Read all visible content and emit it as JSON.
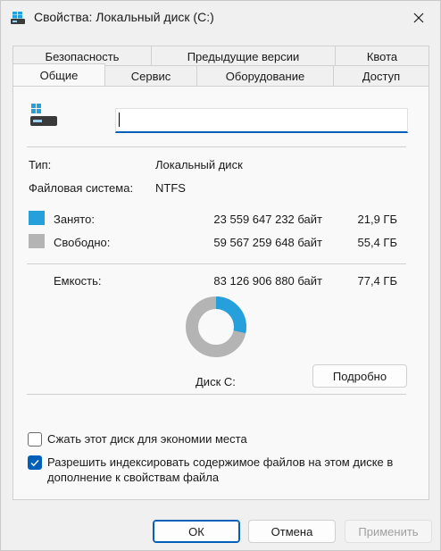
{
  "window": {
    "title": "Свойства: Локальный диск (C:)"
  },
  "tabs_back": [
    "Безопасность",
    "Предыдущие версии",
    "Квота"
  ],
  "tabs_front": [
    "Общие",
    "Сервис",
    "Оборудование",
    "Доступ"
  ],
  "general": {
    "name_value": "",
    "type_label": "Тип:",
    "type_value": "Локальный диск",
    "fs_label": "Файловая система:",
    "fs_value": "NTFS",
    "used_label": "Занято:",
    "used_bytes": "23 559 647 232 байт",
    "used_gb": "21,9 ГБ",
    "free_label": "Свободно:",
    "free_bytes": "59 567 259 648 байт",
    "free_gb": "55,4 ГБ",
    "capacity_label": "Емкость:",
    "capacity_bytes": "83 126 906 880 байт",
    "capacity_gb": "77,4 ГБ",
    "used_fraction": 0.283,
    "used_color": "#26a0da",
    "free_color": "#b4b4b4",
    "disk_label": "Диск C:",
    "details_button": "Подробно",
    "compress_label": "Сжать этот диск для экономии места",
    "compress_checked": false,
    "index_label": "Разрешить индексировать содержимое файлов на этом диске в дополнение к свойствам файла",
    "index_checked": true
  },
  "footer": {
    "ok": "ОК",
    "cancel": "Отмена",
    "apply": "Применить"
  }
}
